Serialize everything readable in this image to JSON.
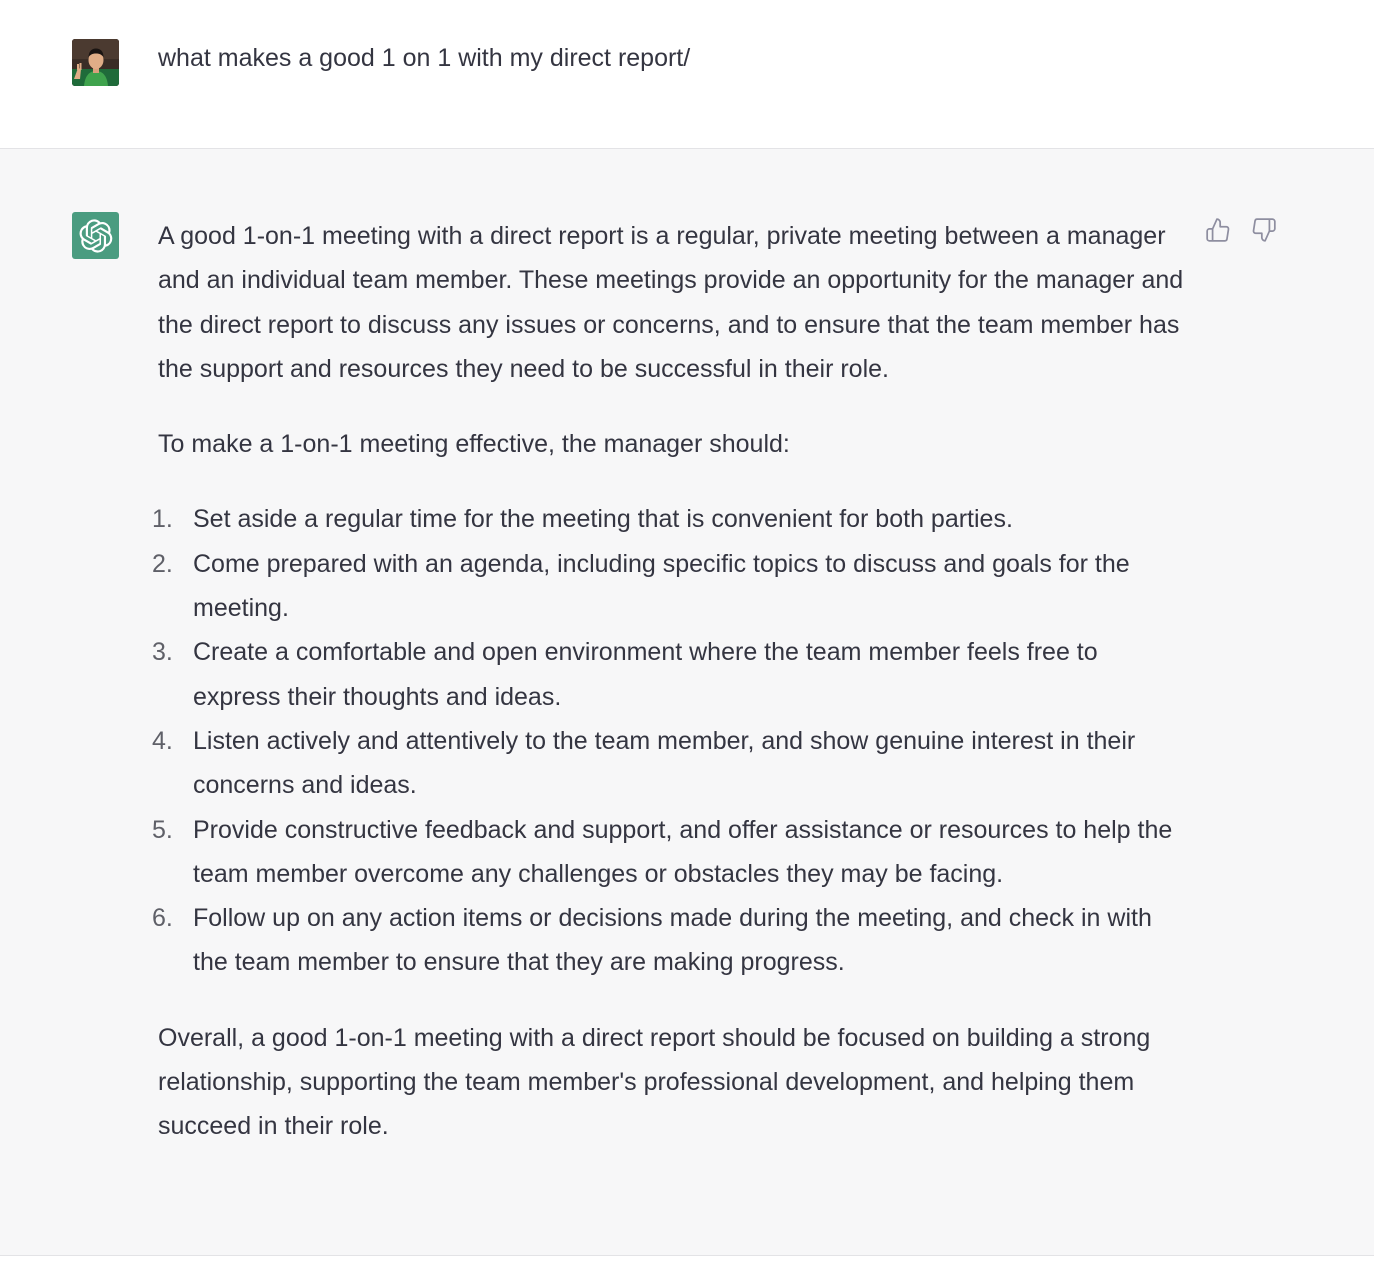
{
  "user_message": {
    "text": "what makes a good 1 on 1 with my direct report/"
  },
  "assistant_message": {
    "intro": "A good 1-on-1 meeting with a direct report is a regular, private meeting between a manager and an individual team member. These meetings provide an opportunity for the manager and the direct report to discuss any issues or concerns, and to ensure that the team member has the support and resources they need to be successful in their role.",
    "lead": "To make a 1-on-1 meeting effective, the manager should:",
    "items": [
      {
        "num": "1.",
        "text": "Set aside a regular time for the meeting that is convenient for both parties."
      },
      {
        "num": "2.",
        "text": "Come prepared with an agenda, including specific topics to discuss and goals for the meeting."
      },
      {
        "num": "3.",
        "text": "Create a comfortable and open environment where the team member feels free to express their thoughts and ideas."
      },
      {
        "num": "4.",
        "text": "Listen actively and attentively to the team member, and show genuine interest in their concerns and ideas."
      },
      {
        "num": "5.",
        "text": "Provide constructive feedback and support, and offer assistance or resources to help the team member overcome any challenges or obstacles they may be facing."
      },
      {
        "num": "6.",
        "text": "Follow up on any action items or decisions made during the meeting, and check in with the team member to ensure that they are making progress."
      }
    ],
    "conclusion": "Overall, a good 1-on-1 meeting with a direct report should be focused on building a strong relationship, supporting the team member's professional development, and helping them succeed in their role."
  },
  "icons": {
    "user_avatar": "user-photo-avatar",
    "bot_avatar": "openai-logo-icon",
    "thumbs_up": "thumbs-up-icon",
    "thumbs_down": "thumbs-down-icon"
  },
  "colors": {
    "bot_avatar_bg": "#4a9c80",
    "assistant_bg": "#f7f7f8",
    "text": "#343541",
    "icon_gray": "#8e8ea0"
  }
}
